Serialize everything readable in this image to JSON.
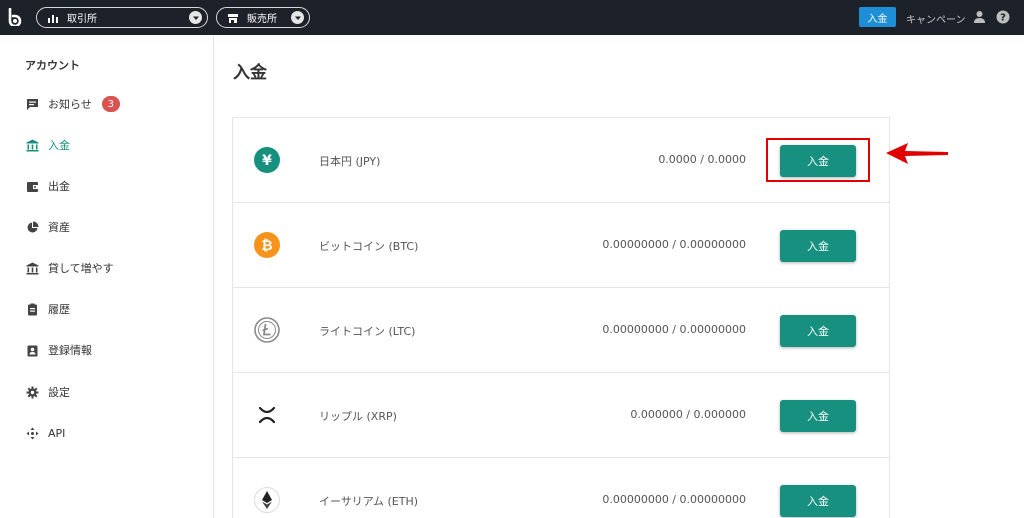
{
  "header": {
    "exchange_label": "取引所",
    "shop_label": "販売所",
    "deposit_label": "入金",
    "campaign_label": "キャンペーン",
    "icons": [
      "bitbank-logo-icon",
      "chart-bars-icon",
      "store-icon",
      "chevron-down-icon",
      "user-icon",
      "help-icon"
    ]
  },
  "sidebar": {
    "heading": "アカウント",
    "notification_count": "3",
    "items": [
      {
        "label": "お知らせ",
        "icon": "message-icon"
      },
      {
        "label": "入金",
        "icon": "bank-icon"
      },
      {
        "label": "出金",
        "icon": "wallet-icon"
      },
      {
        "label": "資産",
        "icon": "pie-chart-icon"
      },
      {
        "label": "貸して増やす",
        "icon": "bank-icon"
      },
      {
        "label": "履歴",
        "icon": "clipboard-icon"
      },
      {
        "label": "登録情報",
        "icon": "id-card-icon"
      },
      {
        "label": "設定",
        "icon": "gear-icon"
      },
      {
        "label": "API",
        "icon": "arrows-icon"
      }
    ]
  },
  "main": {
    "title": "入金",
    "deposit_button_label": "入金",
    "rows": [
      {
        "name": "日本円 (JPY)",
        "balance": "0.0000 / 0.0000",
        "icon": "yen-icon"
      },
      {
        "name": "ビットコイン (BTC)",
        "balance": "0.00000000 / 0.00000000",
        "icon": "bitcoin-icon"
      },
      {
        "name": "ライトコイン (LTC)",
        "balance": "0.00000000 / 0.00000000",
        "icon": "litecoin-icon"
      },
      {
        "name": "リップル (XRP)",
        "balance": "0.000000 / 0.000000",
        "icon": "ripple-icon"
      },
      {
        "name": "イーサリアム (ETH)",
        "balance": "0.00000000 / 0.00000000",
        "icon": "ethereum-icon"
      }
    ]
  },
  "colors": {
    "topbar": "#1d2129",
    "accent_green": "#17907f",
    "header_deposit_blue": "#1e8fd6",
    "badge_red": "#d9534f",
    "annotation_red": "#e00000"
  }
}
